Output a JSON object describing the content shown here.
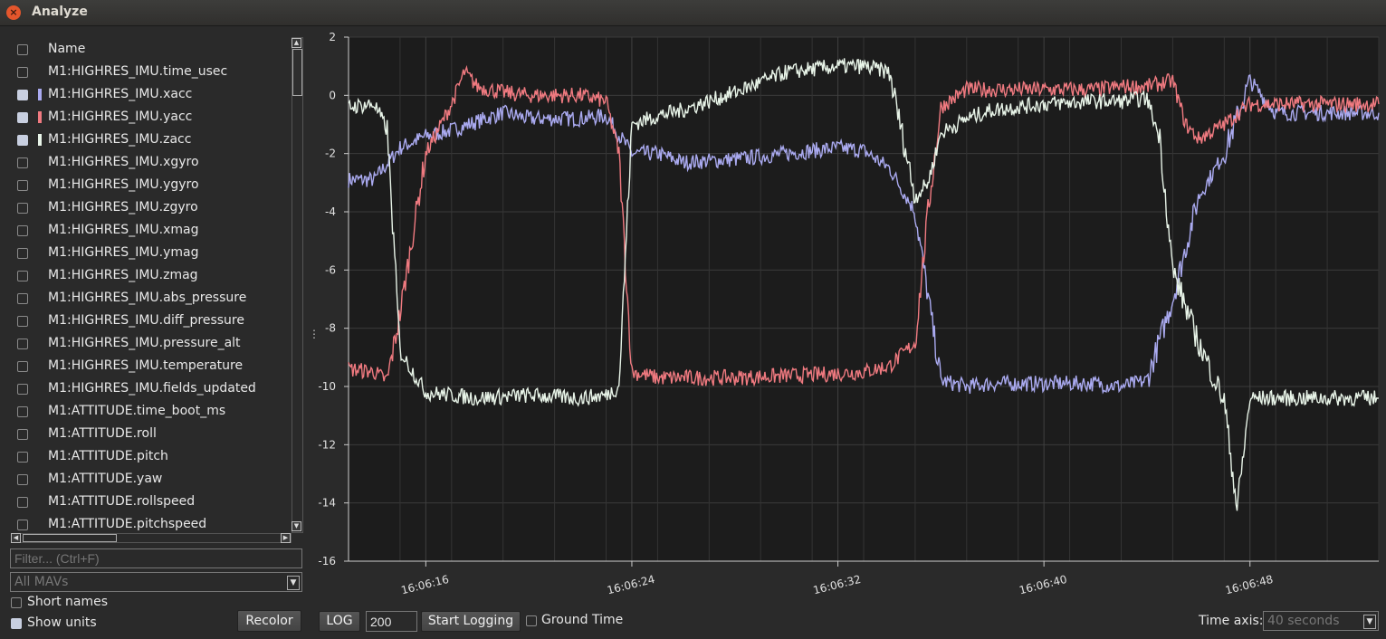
{
  "window": {
    "title": "Analyze",
    "close_icon": "close-icon"
  },
  "list": {
    "header": "Name",
    "items": [
      {
        "label": "M1:HIGHRES_IMU.time_usec",
        "checked": false,
        "color": ""
      },
      {
        "label": "M1:HIGHRES_IMU.xacc",
        "checked": true,
        "color": "#aaaaf0"
      },
      {
        "label": "M1:HIGHRES_IMU.yacc",
        "checked": true,
        "color": "#f07a80"
      },
      {
        "label": "M1:HIGHRES_IMU.zacc",
        "checked": true,
        "color": "#e8f4e8"
      },
      {
        "label": "M1:HIGHRES_IMU.xgyro",
        "checked": false,
        "color": ""
      },
      {
        "label": "M1:HIGHRES_IMU.ygyro",
        "checked": false,
        "color": ""
      },
      {
        "label": "M1:HIGHRES_IMU.zgyro",
        "checked": false,
        "color": ""
      },
      {
        "label": "M1:HIGHRES_IMU.xmag",
        "checked": false,
        "color": ""
      },
      {
        "label": "M1:HIGHRES_IMU.ymag",
        "checked": false,
        "color": ""
      },
      {
        "label": "M1:HIGHRES_IMU.zmag",
        "checked": false,
        "color": ""
      },
      {
        "label": "M1:HIGHRES_IMU.abs_pressure",
        "checked": false,
        "color": ""
      },
      {
        "label": "M1:HIGHRES_IMU.diff_pressure",
        "checked": false,
        "color": ""
      },
      {
        "label": "M1:HIGHRES_IMU.pressure_alt",
        "checked": false,
        "color": ""
      },
      {
        "label": "M1:HIGHRES_IMU.temperature",
        "checked": false,
        "color": ""
      },
      {
        "label": "M1:HIGHRES_IMU.fields_updated",
        "checked": false,
        "color": ""
      },
      {
        "label": "M1:ATTITUDE.time_boot_ms",
        "checked": false,
        "color": ""
      },
      {
        "label": "M1:ATTITUDE.roll",
        "checked": false,
        "color": ""
      },
      {
        "label": "M1:ATTITUDE.pitch",
        "checked": false,
        "color": ""
      },
      {
        "label": "M1:ATTITUDE.yaw",
        "checked": false,
        "color": ""
      },
      {
        "label": "M1:ATTITUDE.rollspeed",
        "checked": false,
        "color": ""
      },
      {
        "label": "M1:ATTITUDE.pitchspeed",
        "checked": false,
        "color": ""
      }
    ]
  },
  "filter": {
    "placeholder": "Filter... (Ctrl+F)"
  },
  "mav_select": {
    "value": "All MAVs"
  },
  "options": {
    "short_names": "Short names",
    "show_units": "Show units",
    "recolor": "Recolor"
  },
  "toolbar": {
    "log_button": "LOG",
    "rate_value": "200",
    "start_logging": "Start Logging",
    "ground_time": "Ground Time",
    "time_axis_label": "Time axis:",
    "time_axis_value": "40 seconds"
  },
  "chart_data": {
    "type": "line",
    "title": "",
    "xlabel": "",
    "ylabel": "",
    "ylim": [
      -16,
      2
    ],
    "xlim": [
      "16:06:13",
      "16:06:53"
    ],
    "yticks": [
      2,
      0,
      -2,
      -4,
      -6,
      -8,
      -10,
      -12,
      -14,
      -16
    ],
    "xticks": [
      "16:06:16",
      "16:06:24",
      "16:06:32",
      "16:06:40",
      "16:06:48"
    ],
    "grid": true,
    "legend": "none",
    "background": "#1c1c1c",
    "series": [
      {
        "color": "#aaaaf0",
        "x": [
          "16:06:13",
          "16:06:14",
          "16:06:15",
          "16:06:16",
          "16:06:17",
          "16:06:18",
          "16:06:19",
          "16:06:20",
          "16:06:21",
          "16:06:22",
          "16:06:23",
          "16:06:24",
          "16:06:25",
          "16:06:26",
          "16:06:28",
          "16:06:30",
          "16:06:32",
          "16:06:33",
          "16:06:34",
          "16:06:35",
          "16:06:36",
          "16:06:37",
          "16:06:38",
          "16:06:40",
          "16:06:42",
          "16:06:43",
          "16:06:44",
          "16:06:45",
          "16:06:46",
          "16:06:47",
          "16:06:48",
          "16:06:49",
          "16:06:51",
          "16:06:53"
        ],
        "y": [
          -2.9,
          -2.9,
          -1.8,
          -1.4,
          -1.2,
          -0.9,
          -0.6,
          -0.8,
          -0.8,
          -0.8,
          -0.7,
          -2.0,
          -2.0,
          -2.3,
          -2.2,
          -2.0,
          -1.8,
          -1.9,
          -2.5,
          -4.0,
          -9.8,
          -10.0,
          -9.9,
          -9.9,
          -9.9,
          -10.0,
          -9.8,
          -7.0,
          -3.5,
          -2.0,
          0.5,
          -0.6,
          -0.6,
          -0.6
        ]
      },
      {
        "color": "#f07a80",
        "x": [
          "16:06:13",
          "16:06:14",
          "16:06:14.5",
          "16:06:15",
          "16:06:16",
          "16:06:17",
          "16:06:17.5",
          "16:06:18",
          "16:06:19",
          "16:06:20",
          "16:06:21",
          "16:06:22",
          "16:06:23",
          "16:06:23.5",
          "16:06:24",
          "16:06:25",
          "16:06:28",
          "16:06:31",
          "16:06:33",
          "16:06:34",
          "16:06:35",
          "16:06:35.5",
          "16:06:36",
          "16:06:37",
          "16:06:38",
          "16:06:40",
          "16:06:42",
          "16:06:43",
          "16:06:44",
          "16:06:45",
          "16:06:45.5",
          "16:06:46",
          "16:06:47",
          "16:06:48",
          "16:06:49",
          "16:06:53"
        ],
        "y": [
          -9.4,
          -9.5,
          -9.8,
          -7.5,
          -2.0,
          -0.3,
          0.8,
          0.3,
          0.1,
          0.0,
          0.0,
          0.0,
          -0.2,
          -2.0,
          -9.5,
          -9.7,
          -9.7,
          -9.6,
          -9.5,
          -9.3,
          -8.5,
          -4.0,
          -0.4,
          0.2,
          0.2,
          0.2,
          0.2,
          0.3,
          0.3,
          0.5,
          -1.0,
          -1.5,
          -1.0,
          -0.3,
          -0.3,
          -0.3
        ]
      },
      {
        "color": "#e8f4e8",
        "x": [
          "16:06:13",
          "16:06:14",
          "16:06:14.5",
          "16:06:15",
          "16:06:16",
          "16:06:18",
          "16:06:20",
          "16:06:22",
          "16:06:23",
          "16:06:23.5",
          "16:06:24",
          "16:06:25",
          "16:06:26",
          "16:06:28",
          "16:06:30",
          "16:06:32",
          "16:06:33",
          "16:06:34",
          "16:06:35",
          "16:06:35.5",
          "16:06:36",
          "16:06:37",
          "16:06:38",
          "16:06:40",
          "16:06:42",
          "16:06:43",
          "16:06:44",
          "16:06:44.5",
          "16:06:45",
          "16:06:46",
          "16:06:47",
          "16:06:47.5",
          "16:06:48",
          "16:06:49",
          "16:06:53"
        ],
        "y": [
          -0.4,
          -0.3,
          -1.2,
          -8.8,
          -10.2,
          -10.4,
          -10.3,
          -10.4,
          -10.3,
          -10.0,
          -1.0,
          -0.7,
          -0.5,
          0.1,
          0.8,
          1.0,
          1.0,
          0.8,
          -3.5,
          -3.0,
          -1.3,
          -0.8,
          -0.5,
          -0.3,
          -0.2,
          -0.2,
          -0.1,
          -1.5,
          -6.0,
          -8.5,
          -10.5,
          -14.2,
          -10.4,
          -10.4,
          -10.4
        ]
      }
    ]
  }
}
